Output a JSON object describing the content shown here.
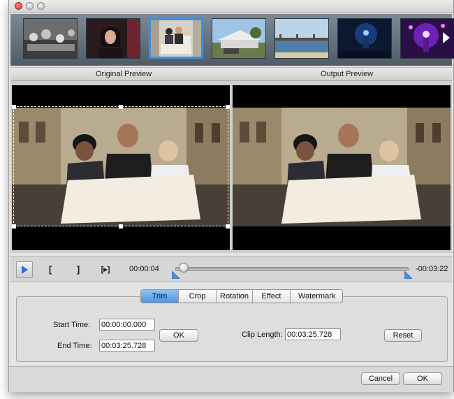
{
  "preview": {
    "original_label": "Original Preview",
    "output_label": "Output Preview"
  },
  "player": {
    "current_time": "00:00:04",
    "remaining_time": "-00:03:22",
    "progress_fraction": 0.02
  },
  "tabs": [
    "Trim",
    "Crop",
    "Rotation",
    "Effect",
    "Watermark"
  ],
  "active_tab": "Trim",
  "trim": {
    "start_label": "Start Time:",
    "start_value": "00:00:00.000",
    "end_label": "End Time:",
    "end_value": "00:03:25.728",
    "ok_label": "OK",
    "clip_length_label": "Clip Length:",
    "clip_length_value": "00:03:25.728",
    "reset_label": "Reset"
  },
  "footer": {
    "cancel_label": "Cancel",
    "ok_label": "OK"
  },
  "icons": {
    "play": "play-icon",
    "mark_in": "mark-in-icon",
    "mark_out": "mark-out-icon",
    "preview_segment": "preview-segment-icon"
  },
  "colors": {
    "accent": "#4f95e3",
    "selection": "#3b8ee8",
    "play": "#2a6fd6"
  }
}
